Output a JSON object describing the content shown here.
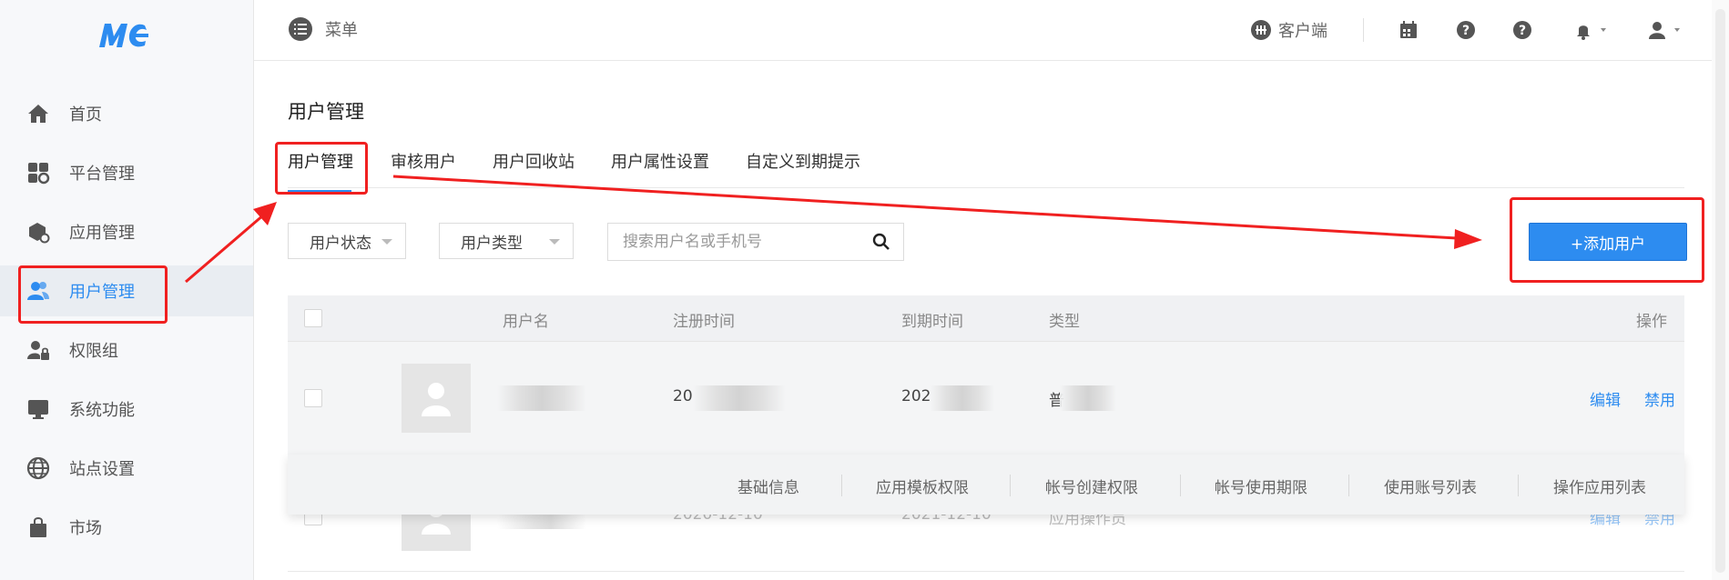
{
  "sidebar": {
    "logo": "MC",
    "items": [
      {
        "label": "首页",
        "icon": "home-icon"
      },
      {
        "label": "平台管理",
        "icon": "grid-gear-icon"
      },
      {
        "label": "应用管理",
        "icon": "package-gear-icon"
      },
      {
        "label": "用户管理",
        "icon": "users-icon",
        "active": true
      },
      {
        "label": "权限组",
        "icon": "user-lock-icon"
      },
      {
        "label": "系统功能",
        "icon": "monitor-icon"
      },
      {
        "label": "站点设置",
        "icon": "globe-icon"
      },
      {
        "label": "市场",
        "icon": "bag-icon"
      }
    ]
  },
  "header": {
    "menu_label": "菜单",
    "client_label": "客户端",
    "icons": [
      "calendar-icon",
      "help-icon",
      "help-icon",
      "bell-icon",
      "user-icon"
    ]
  },
  "main": {
    "title": "用户管理",
    "tabs": [
      "用户管理",
      "审核用户",
      "用户回收站",
      "用户属性设置",
      "自定义到期提示"
    ],
    "filters": {
      "status": "用户状态",
      "type": "用户类型",
      "search_placeholder": "搜索用户名或手机号"
    },
    "add_button": "+添加用户",
    "table": {
      "columns": [
        "用户名",
        "注册时间",
        "到期时间",
        "类型",
        "操作"
      ],
      "rows": [
        {
          "reg_prefix": "20",
          "exp_prefix": "202",
          "type_prefix": "普",
          "actions": [
            "编辑",
            "禁用"
          ]
        },
        {
          "reg": "2020-12-10",
          "exp": "2021-12-10",
          "type": "应用操作员",
          "actions": [
            "编辑",
            "禁用"
          ]
        }
      ]
    },
    "submenu": [
      "基础信息",
      "应用模板权限",
      "帐号创建权限",
      "帐号使用期限",
      "使用账号列表",
      "操作应用列表"
    ]
  },
  "colors": {
    "accent": "#2d8cf0",
    "annotation": "#f02020"
  }
}
